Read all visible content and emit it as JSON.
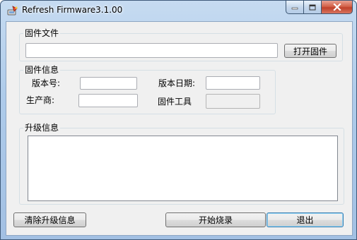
{
  "window": {
    "title": "Refresh Firmware3.1.00"
  },
  "firmware_file": {
    "group_label": "固件文件",
    "path_value": "",
    "open_button": "打开固件"
  },
  "firmware_info": {
    "group_label": "固件信息",
    "version_label": "版本号:",
    "version_value": "",
    "date_label": "版本日期:",
    "date_value": "",
    "vendor_label": "生产商:",
    "vendor_value": "",
    "tool_label": "固件工具",
    "tool_value": ""
  },
  "upgrade_info": {
    "group_label": "升级信息",
    "log": ""
  },
  "buttons": {
    "clear": "清除升级信息",
    "start": "开始烧录",
    "exit": "退出"
  },
  "colors": {
    "titlebar": "#aecbea",
    "client_bg": "#f0f0f0",
    "close_button": "#c0412a"
  }
}
